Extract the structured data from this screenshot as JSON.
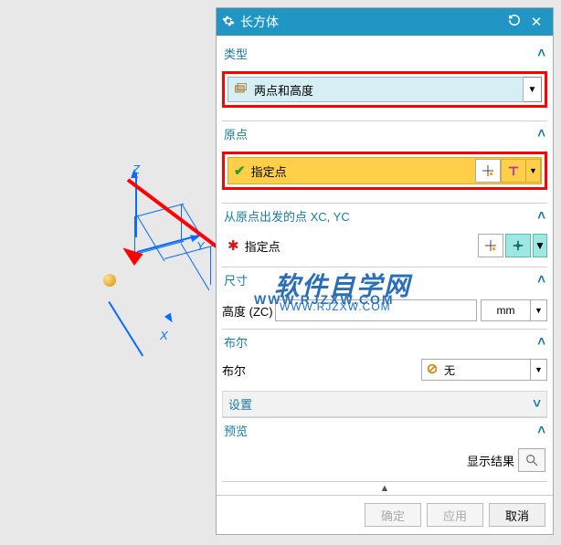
{
  "dialog": {
    "title": "长方体",
    "sections": {
      "type": {
        "label": "类型",
        "selected": "两点和高度"
      },
      "origin": {
        "label": "原点",
        "spec_point_label": "指定点"
      },
      "from_origin": {
        "label": "从原点出发的点 XC, YC",
        "spec_point_label": "指定点"
      },
      "size": {
        "label": "尺寸",
        "height_label": "高度 (ZC)",
        "height_value": "WWW.RJZXW.COM",
        "unit": "mm"
      },
      "bool": {
        "label": "布尔",
        "field_label": "布尔",
        "selected": "无"
      },
      "settings": {
        "label": "设置"
      },
      "preview": {
        "label": "预览",
        "show_result": "显示结果"
      }
    },
    "buttons": {
      "ok": "确定",
      "apply": "应用",
      "cancel": "取消"
    }
  },
  "axes": {
    "x": "X",
    "y": "Y",
    "z": "Z"
  },
  "watermark": {
    "text": "软件自学网",
    "url": "WWW.RJZXW.COM"
  }
}
